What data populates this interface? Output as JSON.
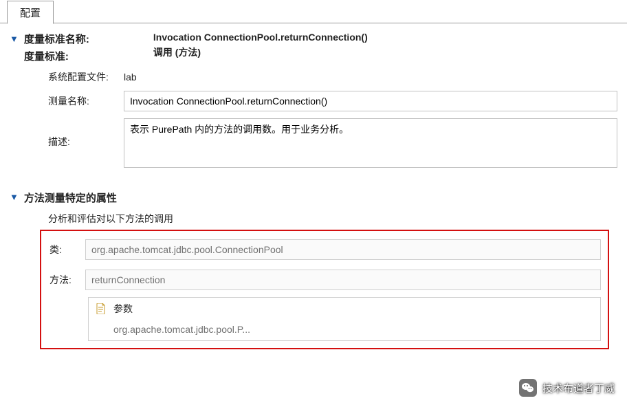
{
  "tabs": {
    "config": "配置"
  },
  "header": {
    "label_name": "度量标准名称:",
    "label_std": "度量标准:",
    "val_name": "Invocation ConnectionPool.returnConnection()",
    "val_std": "调用 (方法)"
  },
  "sys": {
    "profile_label": "系统配置文件:",
    "profile_value": "lab",
    "measure_name_label": "测量名称:",
    "measure_name_value": "Invocation ConnectionPool.returnConnection()",
    "desc_label": "描述:",
    "desc_value": "表示 PurePath 内的方法的调用数。用于业务分析。"
  },
  "sec2": {
    "title": "方法测量特定的属性",
    "subtitle": "分析和评估对以下方法的调用",
    "class_label": "类:",
    "class_value": "org.apache.tomcat.jdbc.pool.ConnectionPool",
    "method_label": "方法:",
    "method_value": "returnConnection",
    "param_header": "参数",
    "param_value": "org.apache.tomcat.jdbc.pool.P..."
  },
  "watermark": {
    "text": "技术布道者丁威"
  }
}
